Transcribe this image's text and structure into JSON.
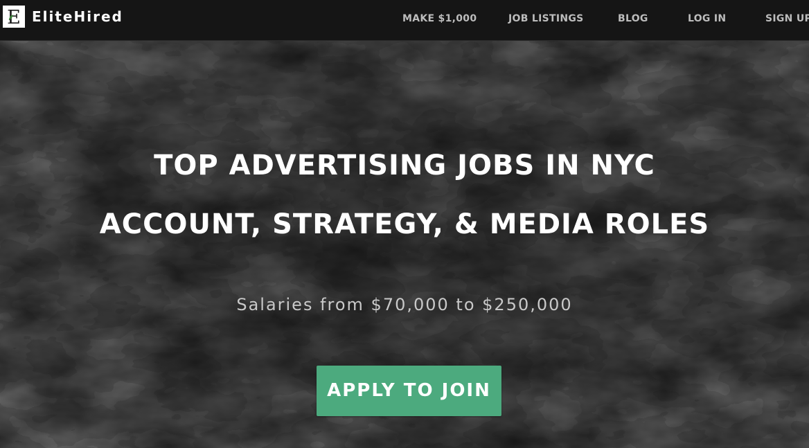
{
  "brand": {
    "name": "EliteHired",
    "logo_letter": "E",
    "logo_icon": "elitehired-logo-icon"
  },
  "nav": {
    "items": [
      {
        "label": "MAKE $1,000"
      },
      {
        "label": "JOB LISTINGS"
      },
      {
        "label": "BLOG"
      },
      {
        "label": "LOG IN"
      },
      {
        "label": "SIGN UP"
      }
    ]
  },
  "hero": {
    "headline_1": "TOP ADVERTISING JOBS IN NYC",
    "headline_2": "ACCOUNT, STRATEGY, & MEDIA ROLES",
    "subheadline": "Salaries from $70,000 to $250,000",
    "cta_label": "APPLY TO JOIN"
  },
  "colors": {
    "nav_background": "#151515",
    "nav_text": "#bdbdbd",
    "hero_text": "#ffffff",
    "cta_background": "#4caa7e",
    "logo_leaf": "#3e8c3b"
  }
}
